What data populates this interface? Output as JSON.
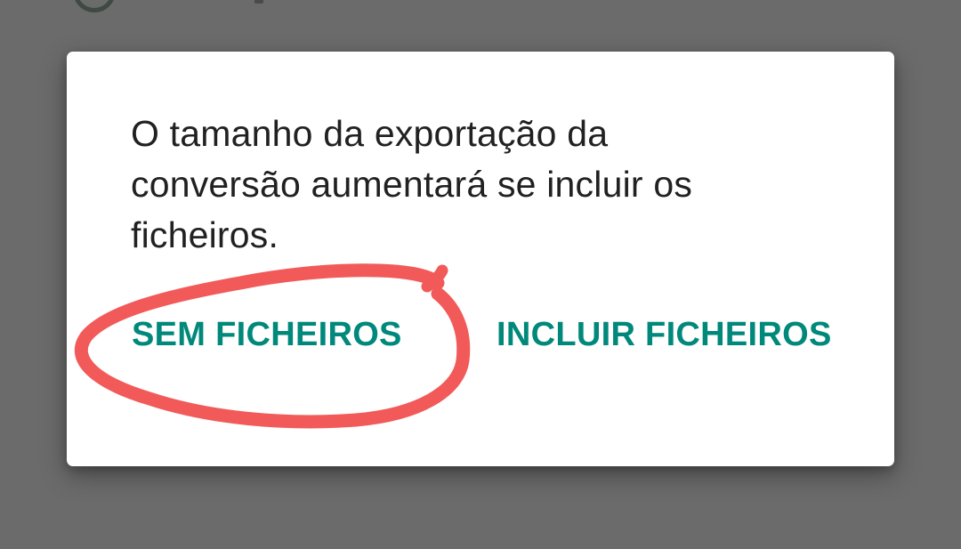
{
  "dialog": {
    "message": "O tamanho da exportação da conversão aumentará se incluir os ficheiros.",
    "buttons": {
      "without_files": "SEM FICHEIROS",
      "include_files": "INCLUIR FICHEIROS"
    }
  },
  "colors": {
    "scrim": "#6b6b6b",
    "dialog_background": "#ffffff",
    "message_text": "#212121",
    "button_text": "#00897b",
    "annotation_stroke": "#f25a5a"
  },
  "icons": {
    "background_partial_icon": "circle-outline-icon"
  },
  "annotation": {
    "type": "hand-drawn-circle",
    "target": "without_files"
  }
}
